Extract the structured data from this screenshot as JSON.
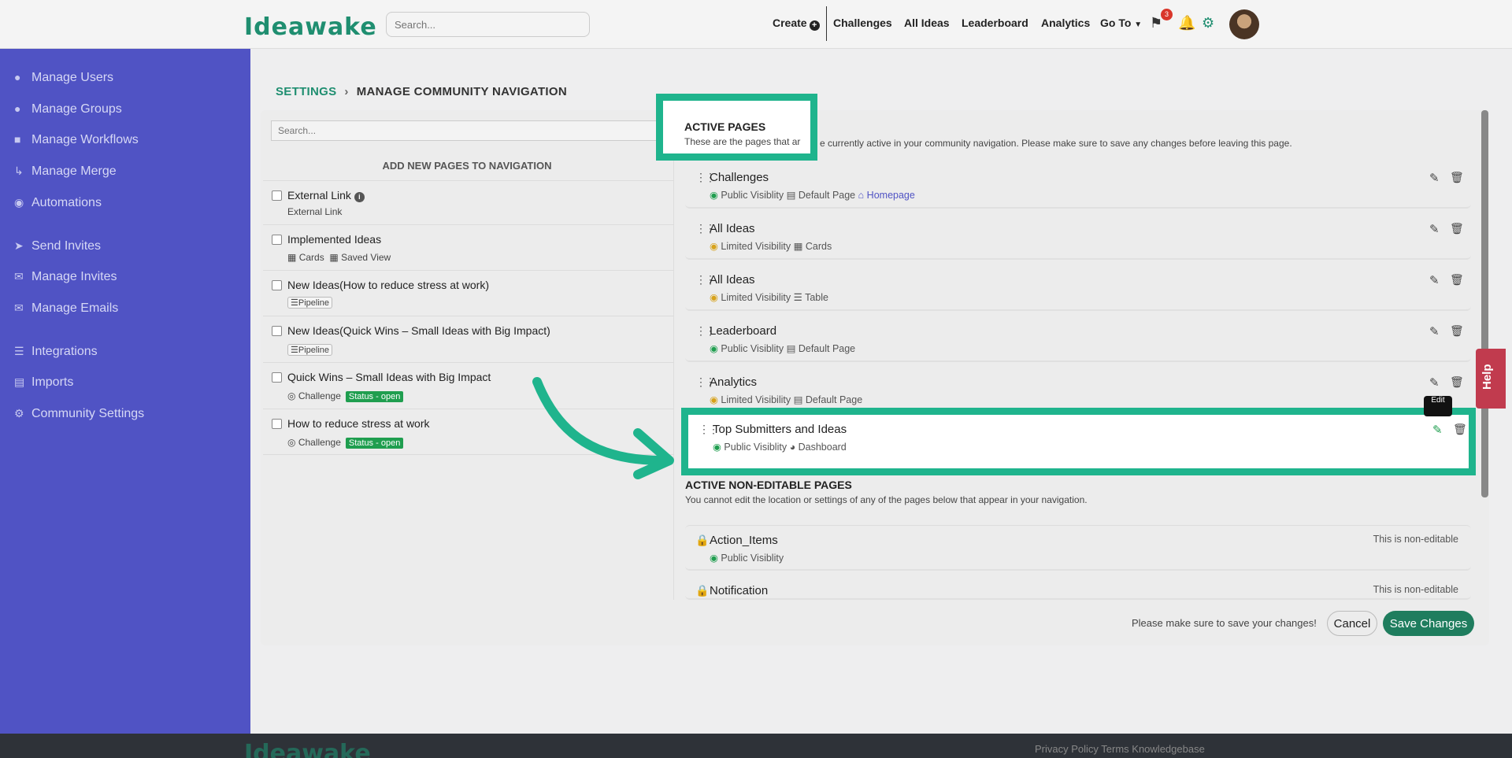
{
  "header": {
    "logo": "Ideawake",
    "search_placeholder": "Search...",
    "nav": {
      "create": "Create",
      "challenges": "Challenges",
      "all_ideas": "All Ideas",
      "leaderboard": "Leaderboard",
      "analytics": "Analytics",
      "goto": "Go To"
    },
    "notification_count": "3",
    "icons": [
      "plus-circle-icon",
      "chevron-down-icon",
      "flag-icon",
      "bell-icon",
      "gear-icon"
    ]
  },
  "sidebar": {
    "items": [
      {
        "label": "Manage Users",
        "icon": "user-icon"
      },
      {
        "label": "Manage Groups",
        "icon": "users-icon"
      },
      {
        "label": "Manage Workflows",
        "icon": "workflow-icon"
      },
      {
        "label": "Manage Merge",
        "icon": "merge-icon"
      },
      {
        "label": "Automations",
        "icon": "robot-icon"
      },
      {
        "label": "Send Invites",
        "icon": "paper-plane-icon"
      },
      {
        "label": "Manage Invites",
        "icon": "envelope-open-icon"
      },
      {
        "label": "Manage Emails",
        "icon": "envelope-icon"
      },
      {
        "label": "Integrations",
        "icon": "database-icon"
      },
      {
        "label": "Imports",
        "icon": "file-icon"
      },
      {
        "label": "Community Settings",
        "icon": "gears-icon"
      }
    ]
  },
  "breadcrumb": {
    "root": "SETTINGS",
    "current": "MANAGE COMMUNITY NAVIGATION"
  },
  "left_panel": {
    "search_placeholder": "Search...",
    "title": "ADD NEW PAGES TO NAVIGATION",
    "items": [
      {
        "name": "External Link",
        "sub": "External Link"
      },
      {
        "name": "Implemented Ideas",
        "sub1": "Cards",
        "sub2": "Saved View"
      },
      {
        "name": "New Ideas(How to reduce stress at work)",
        "tag": "Pipeline"
      },
      {
        "name": "New Ideas(Quick Wins – Small Ideas with Big Impact)",
        "tag": "Pipeline"
      },
      {
        "name": "Quick Wins – Small Ideas with Big Impact",
        "type": "Challenge",
        "status": "Status - open"
      },
      {
        "name": "How to reduce stress at work",
        "type": "Challenge",
        "status": "Status - open"
      }
    ]
  },
  "active_pages": {
    "title": "ACTIVE PAGES",
    "desc_part1": "These are the pages that ar",
    "desc_part2": "e currently active in your community navigation. Please make sure to save any changes before leaving this page.",
    "pages": [
      {
        "name": "Challenges",
        "visibility": "Public Visiblity",
        "type": "Default Page",
        "extra": "Homepage"
      },
      {
        "name": "All Ideas",
        "visibility": "Limited Visibility",
        "type": "Cards"
      },
      {
        "name": "All Ideas",
        "visibility": "Limited Visibility",
        "type": "Table"
      },
      {
        "name": "Leaderboard",
        "visibility": "Public Visiblity",
        "type": "Default Page"
      },
      {
        "name": "Analytics",
        "visibility": "Limited Visibility",
        "type": "Default Page"
      },
      {
        "name": "Top Submitters and Ideas",
        "visibility": "Public Visiblity",
        "type": "Dashboard"
      }
    ],
    "tooltip": "Edit"
  },
  "non_editable": {
    "title": "ACTIVE NON-EDITABLE PAGES",
    "desc": "You cannot edit the location or settings of any of the pages below that appear in your navigation.",
    "note": "This is non-editable",
    "pages": [
      {
        "name": "Action_Items",
        "visibility": "Public Visiblity"
      },
      {
        "name": "Notification"
      }
    ]
  },
  "actions": {
    "note": "Please make sure to save your changes!",
    "cancel": "Cancel",
    "save": "Save Changes"
  },
  "help": "Help",
  "footer": {
    "logo": "Ideawake",
    "links": "Privacy Policy   Terms   Knowledgebase"
  },
  "colors": {
    "accent": "#1f8e70",
    "sidebar": "#5053c4",
    "highlight": "#1fb48d",
    "save_button": "#1f7d5e",
    "status_badge": "#1f9e4f"
  }
}
